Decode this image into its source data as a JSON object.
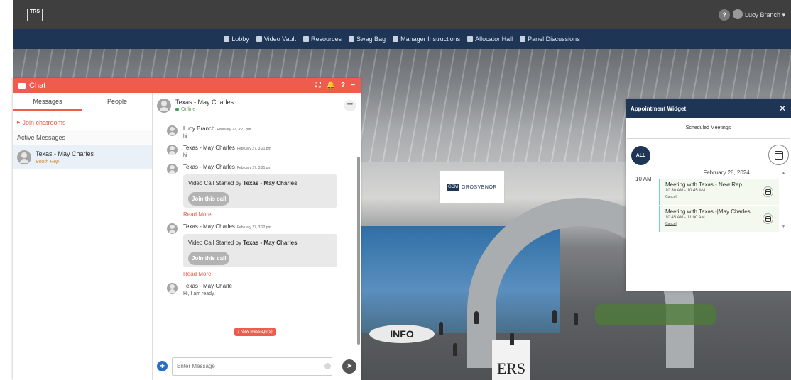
{
  "topbar": {
    "logo_text": "TRS",
    "help_label": "?",
    "user_name": "Lucy Branch ▾"
  },
  "nav": {
    "items": [
      {
        "label": "Lobby",
        "icon": "lobby-icon"
      },
      {
        "label": "Video Vault",
        "icon": "video-icon"
      },
      {
        "label": "Resources",
        "icon": "folder-icon"
      },
      {
        "label": "Swag Bag",
        "icon": "bag-icon"
      },
      {
        "label": "Manager Instructions",
        "icon": "download-icon"
      },
      {
        "label": "Allocator Hall",
        "icon": "building-icon"
      },
      {
        "label": "Panel Discussions",
        "icon": "list-icon"
      }
    ]
  },
  "scene": {
    "booth_sign_logo": "GCM",
    "booth_sign_text": "GROSVENOR",
    "info_desk": "INFO",
    "ers_sign": "ERS"
  },
  "chat": {
    "title": "Chat",
    "header_actions": [
      "⛶",
      "🔔",
      "?",
      "−"
    ],
    "tabs": [
      "Messages",
      "People"
    ],
    "join_chatrooms": "Join chatrooms",
    "section_label": "Active Messages",
    "active_item": {
      "name": "Texas - May Charles",
      "role": "Booth Rep"
    },
    "conversation": {
      "name": "Texas - May Charles",
      "status": "Online",
      "more": "•••",
      "messages": [
        {
          "author": "Lucy Branch",
          "time": "February 27, 3:21 pm",
          "text": "hi"
        },
        {
          "author": "Texas - May Charles",
          "time": "February 27, 3:21 pm",
          "text": "hi"
        },
        {
          "author": "Texas - May Charles",
          "time": "February 27, 3:21 pm",
          "call_prefix": "Video Call Started by ",
          "call_by": "Texas - May Charles",
          "join_label": "Join this call",
          "read_more": "Read More"
        },
        {
          "author": "Texas - May Charles",
          "time": "February 27, 3:22 pm",
          "call_prefix": "Video Call Started by ",
          "call_by": "Texas - May Charles",
          "join_label": "Join this call",
          "read_more": "Read More"
        },
        {
          "author": "Texas - May Charle",
          "time": "",
          "text": "Hi, I am ready."
        }
      ],
      "new_messages_badge": "↓ New Message(s)"
    },
    "composer": {
      "placeholder": "Enter Message",
      "plus": "+",
      "send": "➤"
    }
  },
  "appointment": {
    "title": "Appointment Widget",
    "close": "✕",
    "subtitle": "Scheduled Meetings",
    "all_label": "ALL",
    "date": "February 28, 2024",
    "time_label": "10 AM",
    "meetings": [
      {
        "title": "Meeting with Texas - New Rep",
        "time": "10:30 AM - 10:45 AM",
        "cancel": "Cancel"
      },
      {
        "title": "Meeting with Texas -|May Charles",
        "time": "10:45 AM - 11:00 AM",
        "cancel": "Cancel"
      }
    ],
    "scroll_up": "▲",
    "scroll_down": "▼"
  }
}
